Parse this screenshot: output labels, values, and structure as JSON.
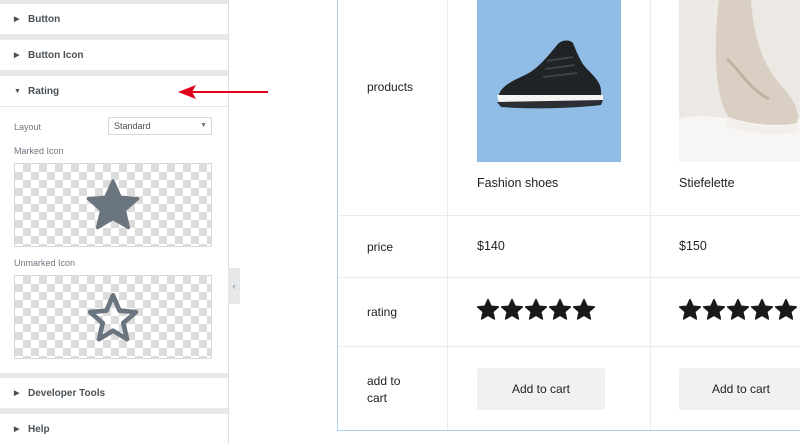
{
  "panel": {
    "sections": {
      "button": "Button",
      "button_icon": "Button Icon",
      "rating": "Rating",
      "developer_tools": "Developer Tools",
      "help": "Help"
    },
    "rating": {
      "layout_label": "Layout",
      "layout_value": "Standard",
      "marked_icon_label": "Marked Icon",
      "unmarked_icon_label": "Unmarked Icon"
    }
  },
  "table": {
    "rows": {
      "products": "products",
      "price": "price",
      "rating": "rating",
      "add_to_cart": "add to cart"
    },
    "products": [
      {
        "name": "Fashion shoes",
        "price": "$140",
        "rating": 5,
        "button": "Add to cart"
      },
      {
        "name": "Stiefelette",
        "price": "$150",
        "rating": 5,
        "button": "Add to cart"
      }
    ]
  },
  "colors": {
    "annotation_arrow": "#e0001b",
    "star_marked": "#6b7580",
    "star_rating": "#1a1a1a",
    "product_bg_1": "#8fbde6",
    "table_border": "#a7d2e8"
  }
}
